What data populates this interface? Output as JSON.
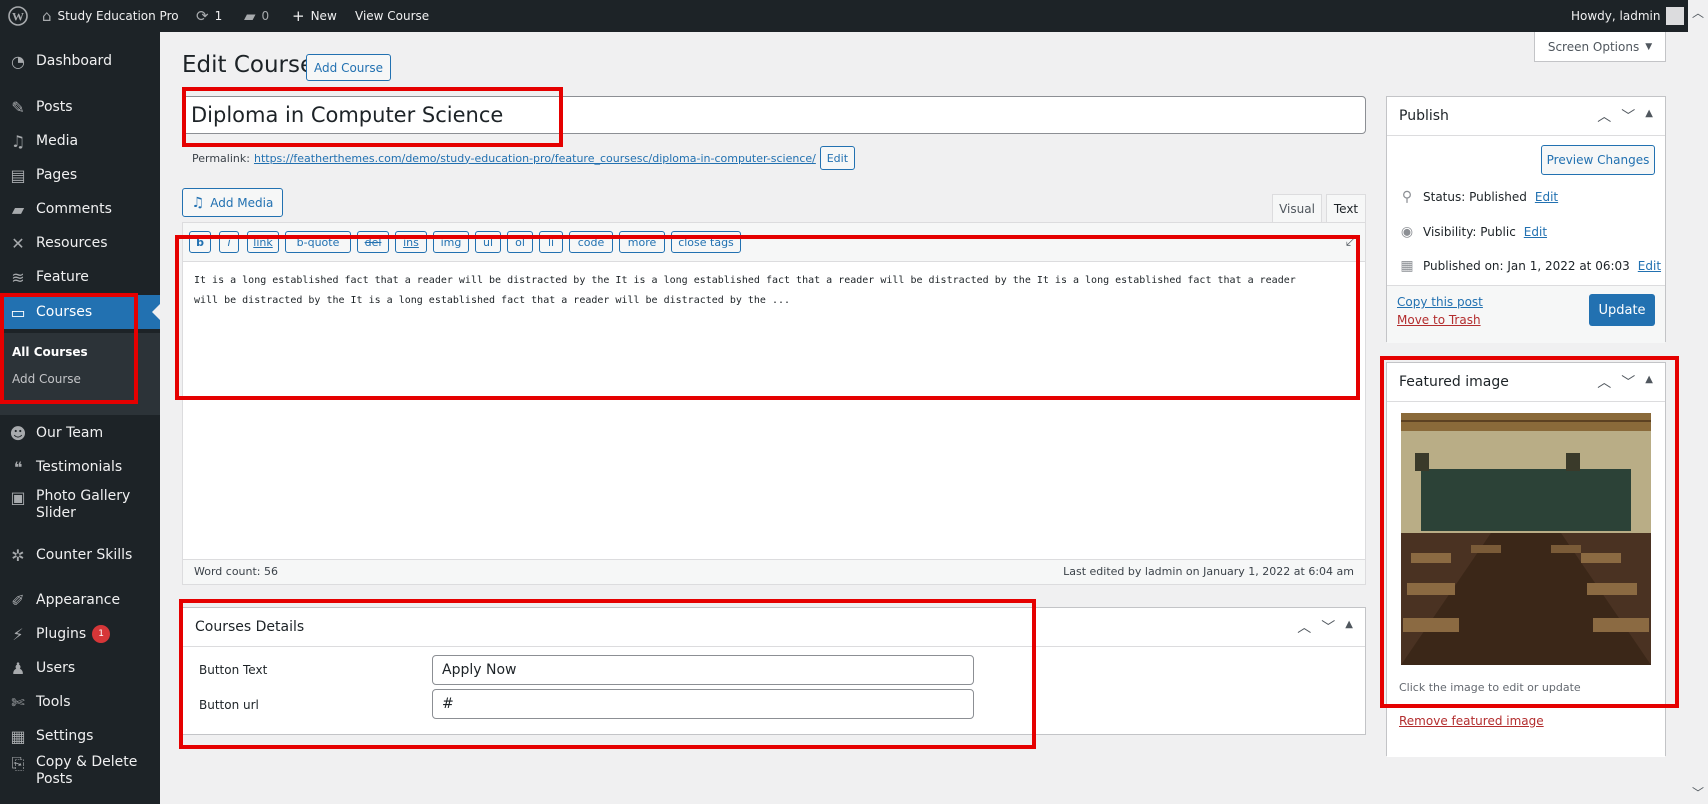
{
  "adminbar": {
    "site_name": "Study Education Pro",
    "updates_count": "1",
    "comments_count": "0",
    "new_label": "New",
    "view_label": "View Course",
    "howdy": "Howdy, ladmin"
  },
  "sidebar": {
    "items": [
      {
        "label": "Dashboard",
        "icon": "dashboard-icon"
      },
      {
        "label": "Posts",
        "icon": "pin-icon"
      },
      {
        "label": "Media",
        "icon": "media-icon"
      },
      {
        "label": "Pages",
        "icon": "pages-icon"
      },
      {
        "label": "Comments",
        "icon": "comments-icon"
      },
      {
        "label": "Resources",
        "icon": "resources-icon"
      },
      {
        "label": "Feature",
        "icon": "feature-icon"
      },
      {
        "label": "Courses",
        "icon": "courses-icon"
      },
      {
        "label": "Our Team",
        "icon": "team-icon"
      },
      {
        "label": "Testimonials",
        "icon": "quote-icon"
      },
      {
        "label": "Photo Gallery Slider",
        "icon": "gallery-icon"
      },
      {
        "label": "Counter Skills",
        "icon": "counter-icon"
      },
      {
        "label": "Appearance",
        "icon": "appearance-icon"
      },
      {
        "label": "Plugins",
        "icon": "plugins-icon",
        "badge": "1"
      },
      {
        "label": "Users",
        "icon": "users-icon"
      },
      {
        "label": "Tools",
        "icon": "tools-icon"
      },
      {
        "label": "Settings",
        "icon": "settings-icon"
      },
      {
        "label": "Copy & Delete Posts",
        "icon": "copy-icon"
      }
    ],
    "submenu": {
      "all_courses": "All Courses",
      "add_course": "Add Course"
    }
  },
  "header": {
    "title": "Edit Course",
    "add_button": "Add Course",
    "screen_options": "Screen Options"
  },
  "post": {
    "title": "Diploma in Computer Science",
    "permalink_label": "Permalink:",
    "permalink_url": "https://featherthemes.com/demo/study-education-pro/feature_coursesc/diploma-in-computer-science/",
    "permalink_edit": "Edit",
    "add_media": "Add Media",
    "tab_visual": "Visual",
    "tab_text": "Text",
    "quicktags": [
      "b",
      "i",
      "link",
      "b-quote",
      "del",
      "ins",
      "img",
      "ul",
      "ol",
      "li",
      "code",
      "more",
      "close tags"
    ],
    "content_line1": "It is a long established fact that a reader will be distracted by the It is a long established fact that a reader will be distracted by the It is a long established fact that a reader",
    "content_line2": "will be distracted by the It is a long established fact that a reader will be distracted by the ...",
    "word_count": "Word count: 56",
    "last_edited": "Last edited by ladmin on January 1, 2022 at 6:04 am"
  },
  "courses_details": {
    "title": "Courses Details",
    "button_text_label": "Button Text",
    "button_text_value": "Apply Now",
    "button_url_label": "Button url",
    "button_url_value": "#"
  },
  "publish": {
    "title": "Publish",
    "preview": "Preview Changes",
    "status": "Status: Published",
    "visibility": "Visibility: Public",
    "published_on": "Published on: Jan 1, 2022 at 06:03",
    "edit": "Edit",
    "copy_post": "Copy this post",
    "trash": "Move to Trash",
    "update": "Update"
  },
  "featured": {
    "title": "Featured image",
    "hint": "Click the image to edit or update",
    "remove": "Remove featured image"
  }
}
